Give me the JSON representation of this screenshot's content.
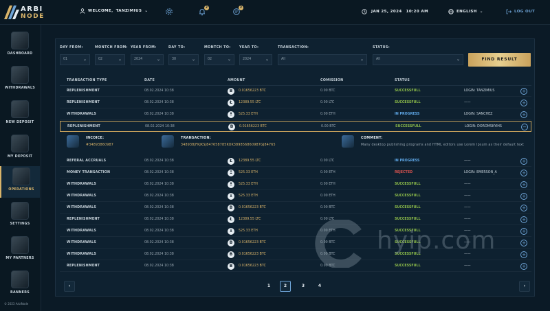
{
  "logo": {
    "line1": "ARBI",
    "line2": "NODE"
  },
  "header": {
    "welcome_prefix": "WELCOME,",
    "username": "TANZIMIUS",
    "notifications_count": "2",
    "messages_count": "2",
    "date": "JAN 25, 2024",
    "time": "10:20 AM",
    "language": "ENGLISH",
    "logout": "LOG OUT"
  },
  "sidebar": {
    "items": [
      {
        "label": "DASHBOARD",
        "icon": "dashboard-icon"
      },
      {
        "label": "WITHDRAWALS",
        "icon": "withdrawals-icon"
      },
      {
        "label": "NEW DEPOSIT",
        "icon": "new-deposit-icon"
      },
      {
        "label": "MY DEPOSIT",
        "icon": "my-deposit-icon"
      },
      {
        "label": "OPERATIONS",
        "icon": "operations-icon",
        "active": true
      },
      {
        "label": "SETTINGS",
        "icon": "settings-icon"
      },
      {
        "label": "MY PARTNERS",
        "icon": "partners-icon"
      },
      {
        "label": "BANNERS",
        "icon": "banners-icon"
      }
    ],
    "copyright": "© 2023 ArbiNode"
  },
  "filters": {
    "day_from": {
      "label": "DAY FROM:",
      "value": "01"
    },
    "month_from": {
      "label": "MONTCH FROM:",
      "value": "02"
    },
    "year_from": {
      "label": "YEAR FROM:",
      "value": "2024"
    },
    "day_to": {
      "label": "DAY TO:",
      "value": "30"
    },
    "month_to": {
      "label": "MONTCH TO:",
      "value": "02"
    },
    "year_to": {
      "label": "YEAR TO:",
      "value": "2024"
    },
    "transaction": {
      "label": "TRANSACTION:",
      "value": "All"
    },
    "status": {
      "label": "STATUS:",
      "value": "All"
    },
    "find_button": "FIND RESULT"
  },
  "table": {
    "headers": {
      "type": "TRANSACTION TYPE",
      "date": "DATE",
      "amount": "AMOUNT",
      "commission": "COMISSION",
      "status": "STATUS"
    },
    "rows": [
      {
        "type": "REPLENISHMENT",
        "date": "08.02.2024 10:38",
        "coin": "B",
        "amount": "0.01656223 BTC",
        "commission": "0.00 BTC",
        "status": "SUCCESSFULL",
        "status_color": "#8fbf4a",
        "login": "LOGIN: TANZIMIUS"
      },
      {
        "type": "REPLENISHMENT",
        "date": "08.02.2024 10:38",
        "coin": "Ł",
        "amount": "12389.55 LTC",
        "commission": "0.00 LTC",
        "status": "SUCCESSFULL",
        "status_color": "#8fbf4a",
        "login": "——"
      },
      {
        "type": "WITHDRAWALS",
        "date": "08.02.2024 10:38",
        "coin": "Ξ",
        "amount": "525.33 ETH",
        "commission": "0.00 ETH",
        "status": "IN PROGRESS",
        "status_color": "#5fa8e8",
        "login": "LOGIN: SANCHEZ"
      },
      {
        "type": "REPLENISHMENT",
        "date": "08.02.2024 10:38",
        "coin": "B",
        "amount": "0.01656223 BTC",
        "commission": "0.00 BTC",
        "status": "SUCCESSFULL",
        "status_color": "#8fbf4a",
        "login": "LOGIN: DOROMSKYIHS",
        "expanded": true
      },
      {
        "type": "REFERAL ACCRUALS",
        "date": "08.02.2024 10:38",
        "coin": "Ł",
        "amount": "12389.55 LTC",
        "commission": "0.00 LTC",
        "status": "IN PROGRESS",
        "status_color": "#5fa8e8",
        "login": "——"
      },
      {
        "type": "MONEY TRANSACTION",
        "date": "08.02.2024 10:38",
        "coin": "Ξ",
        "amount": "525.33 ETH",
        "commission": "0.00 ETH",
        "status": "REJECTED",
        "status_color": "#d9534f",
        "login": "LOGIN: EMERSON_A"
      },
      {
        "type": "WITHDRAWALS",
        "date": "08.02.2024 10:38",
        "coin": "Ξ",
        "amount": "525.33 ETH",
        "commission": "0.00 ETH",
        "status": "SUCCESSFULL",
        "status_color": "#8fbf4a",
        "login": "——"
      },
      {
        "type": "WITHDRAWALS",
        "date": "08.02.2024 10:38",
        "coin": "Ξ",
        "amount": "525.33 ETH",
        "commission": "0.00 ETH",
        "status": "SUCCESSFULL",
        "status_color": "#8fbf4a",
        "login": "——"
      },
      {
        "type": "WITHDRAWALS",
        "date": "08.02.2024 10:38",
        "coin": "B",
        "amount": "0.01656223 BTC",
        "commission": "0.00 BTC",
        "status": "SUCCESSFULL",
        "status_color": "#8fbf4a",
        "login": "——"
      },
      {
        "type": "REPLENISHMENT",
        "date": "08.02.2024 10:38",
        "coin": "Ł",
        "amount": "12389.55 LTC",
        "commission": "0.00 LTC",
        "status": "SUCCESSFULL",
        "status_color": "#8fbf4a",
        "login": "——"
      },
      {
        "type": "WITHDRAWALS",
        "date": "08.02.2024 10:38",
        "coin": "Ξ",
        "amount": "525.33 ETH",
        "commission": "0.00 ETH",
        "status": "SUCCESSFULL",
        "status_color": "#8fbf4a",
        "login": "——"
      },
      {
        "type": "WITHDRAWALS",
        "date": "08.02.2024 10:38",
        "coin": "B",
        "amount": "0.01656223 BTC",
        "commission": "0.00 BTC",
        "status": "SUCCESSFULL",
        "status_color": "#8fbf4a",
        "login": "——"
      },
      {
        "type": "WITHDRAWALS",
        "date": "08.02.2024 10:38",
        "coin": "B",
        "amount": "0.01656223 BTC",
        "commission": "0.00 BTC",
        "status": "SUCCESSFULL",
        "status_color": "#8fbf4a",
        "login": "——"
      },
      {
        "type": "REPLENISHMENT",
        "date": "08.02.2024 10:38",
        "coin": "B",
        "amount": "0.01656223 BTC",
        "commission": "0.00 BTC",
        "status": "SUCCESSFULL",
        "status_color": "#8fbf4a",
        "login": "——"
      }
    ],
    "detail": {
      "invoice_label": "INCOICE:",
      "invoice_value": "#34893860987",
      "transaction_label": "TRANSACTION:",
      "transaction_value": "348938JFKJKSJ847658785KOK389856860987GJ84765",
      "comment_label": "COMMENT:",
      "comment_value": "Many desktop publishing programs and HTML editors use Lorem Ipsum as their default text"
    }
  },
  "pagination": {
    "pages": [
      "1",
      "2",
      "3",
      "4"
    ],
    "current": "2",
    "prev": "‹",
    "next": "›"
  },
  "watermark": "hyip.com",
  "colors": {
    "accent_gold": "#d9b46a",
    "accent_blue": "#6fa5d8",
    "bg": "#0b1a26"
  }
}
